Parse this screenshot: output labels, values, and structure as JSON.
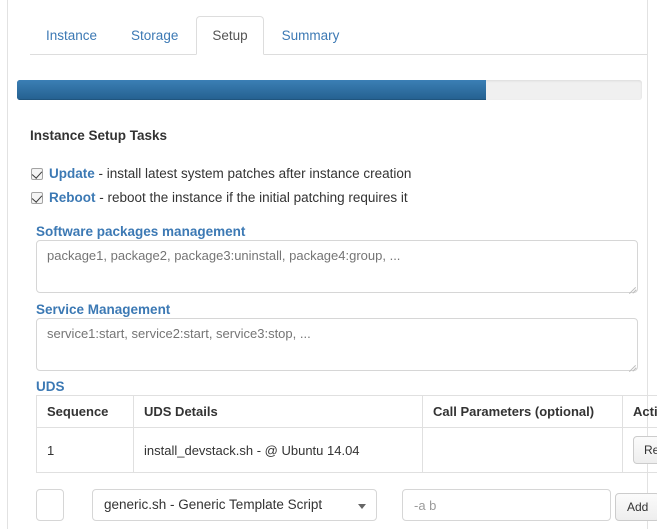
{
  "wizard": {
    "tabs": [
      {
        "label": "Instance",
        "active": false
      },
      {
        "label": "Storage",
        "active": false
      },
      {
        "label": "Setup",
        "active": true
      },
      {
        "label": "Summary",
        "active": false
      }
    ],
    "progress": {
      "percent": 75,
      "fill_color": "#2a6ca5",
      "track_color": "#f0f0f0"
    },
    "accent_color": "#3c79b4"
  },
  "setup": {
    "section_title": "Instance Setup Tasks",
    "tasks": [
      {
        "name": "Update",
        "description": " - install latest system patches after instance creation",
        "checked": true
      },
      {
        "name": "Reboot",
        "description": " - reboot the instance if the initial patching requires it",
        "checked": true
      }
    ],
    "packages": {
      "label": "Software packages management",
      "value": "",
      "placeholder": "package1, package2, package3:uninstall, package4:group, ..."
    },
    "services": {
      "label": "Service Management",
      "value": "",
      "placeholder": "service1:start, service2:start, service3:stop, ..."
    },
    "uds": {
      "label": "UDS",
      "columns": [
        "Sequence",
        "UDS Details",
        "Call Parameters (optional)",
        "Action"
      ],
      "rows": [
        {
          "sequence": "1",
          "details": "install_devstack.sh - @ Ubuntu 14.04",
          "parameters": "",
          "action_label": "Remove"
        }
      ],
      "add_row": {
        "sequence_value": "",
        "sequence_placeholder": "",
        "script_selected": "generic.sh - Generic Template Script",
        "params_value": "",
        "params_placeholder": "-a b",
        "add_label": "Add",
        "caret_icon": "chevron-down-icon"
      }
    }
  }
}
